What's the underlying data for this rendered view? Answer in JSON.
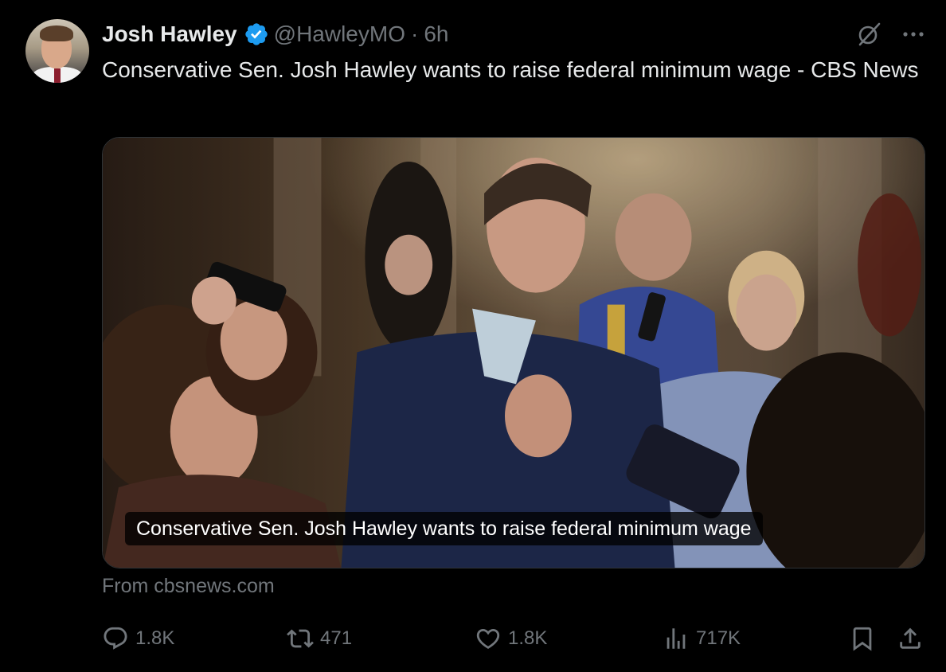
{
  "author": {
    "name": "Josh Hawley",
    "handle": "@HawleyMO",
    "separator": "·",
    "time": "6h",
    "verified_icon": "verified-badge-icon"
  },
  "tweet": {
    "text": "Conservative Sen. Josh Hawley wants to raise federal minimum wage - CBS News"
  },
  "card": {
    "caption": "Conservative Sen. Josh Hawley wants to raise federal minimum wage",
    "source": "From cbsnews.com"
  },
  "actions": {
    "replies": "1.8K",
    "retweets": "471",
    "likes": "1.8K",
    "views": "717K"
  },
  "colors": {
    "background": "#000000",
    "text": "#e7e9ea",
    "muted": "#71767b",
    "verified": "#1d9bf0",
    "border": "#2f3336"
  }
}
